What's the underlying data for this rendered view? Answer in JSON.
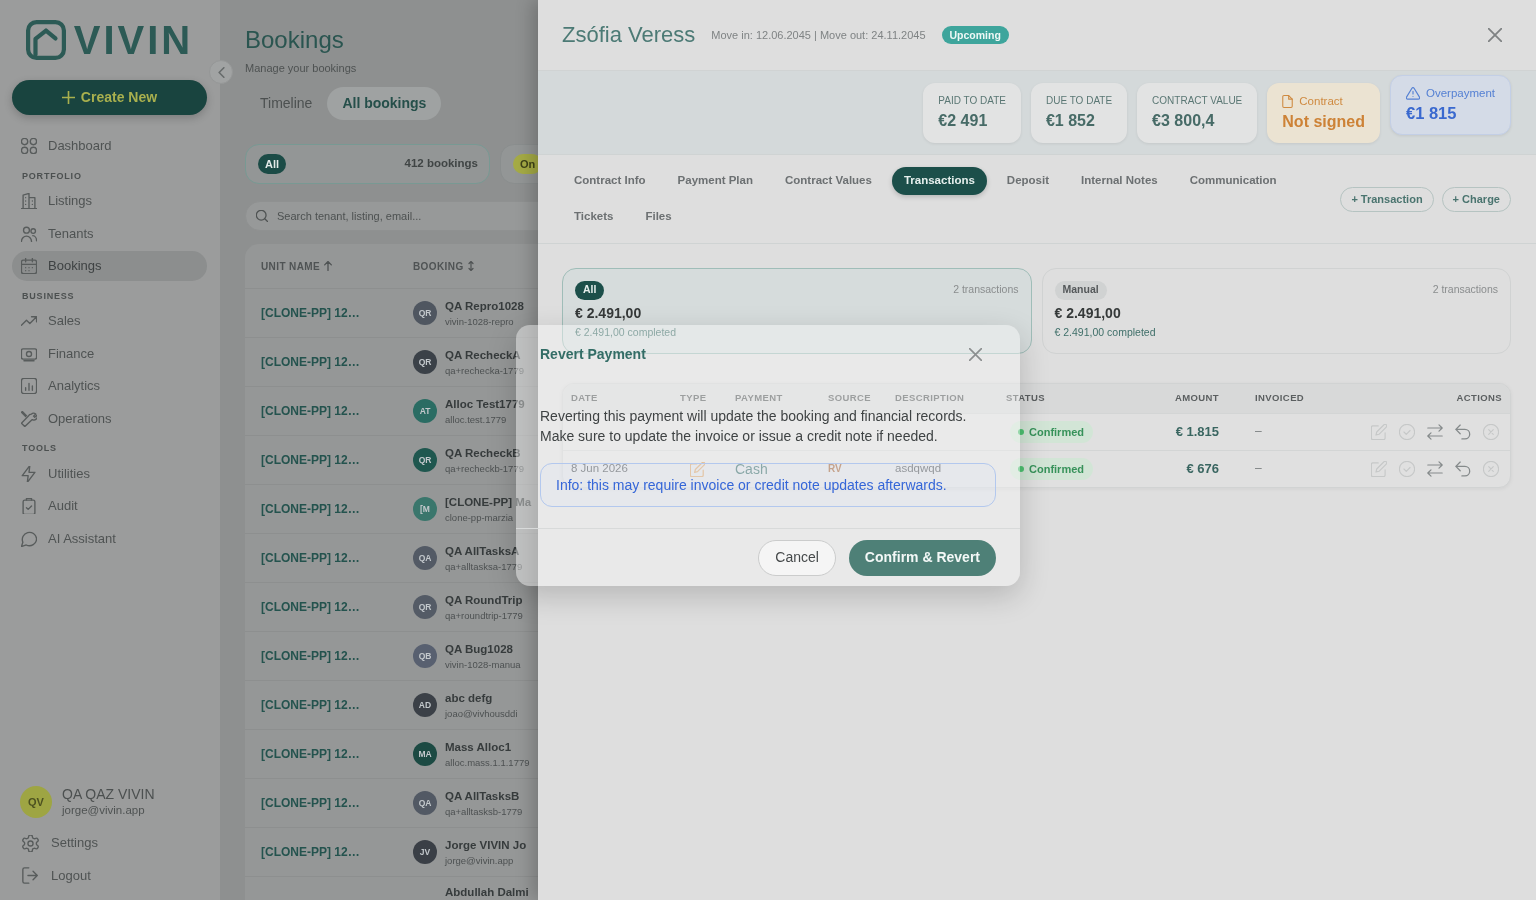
{
  "sidebar": {
    "logo": "VIVIN",
    "create_button": "Create New",
    "nav": [
      {
        "items": [
          {
            "label": "Dashboard",
            "selected": false
          }
        ]
      },
      {
        "heading": "PORTFOLIO",
        "items": [
          {
            "label": "Listings",
            "selected": false
          },
          {
            "label": "Tenants",
            "selected": false
          },
          {
            "label": "Bookings",
            "selected": true
          }
        ]
      },
      {
        "heading": "BUSINESS",
        "items": [
          {
            "label": "Sales",
            "selected": false
          },
          {
            "label": "Finance",
            "selected": false
          },
          {
            "label": "Analytics",
            "selected": false
          },
          {
            "label": "Operations",
            "selected": false
          }
        ]
      },
      {
        "heading": "TOOLS",
        "items": [
          {
            "label": "Utilities",
            "selected": false
          },
          {
            "label": "Audit",
            "selected": false
          },
          {
            "label": "AI Assistant",
            "selected": false
          }
        ]
      }
    ],
    "user": {
      "initials": "QV",
      "name": "QA QAZ VIVIN",
      "email": "jorge@vivin.app"
    },
    "footer_items": [
      {
        "label": "Settings"
      },
      {
        "label": "Logout"
      }
    ]
  },
  "bookings_page": {
    "title": "Bookings",
    "subtitle": "Manage your bookings",
    "view_tabs": [
      {
        "label": "Timeline",
        "selected": false
      },
      {
        "label": "All bookings",
        "selected": true
      }
    ],
    "filters": [
      {
        "label": "All",
        "count": "412 bookings",
        "selected": true,
        "color": "#1b4b46"
      },
      {
        "label": "On",
        "selected": false,
        "color": "#a5ab45"
      }
    ],
    "search": {
      "placeholder": "Search tenant, listing, email..."
    },
    "table": {
      "columns": [
        {
          "label": "UNIT NAME",
          "sorted": true
        },
        {
          "label": "BOOKING",
          "sorted": false
        }
      ],
      "rows": [
        {
          "unit": "[CLONE-PP] 12…",
          "initials": "QR",
          "color": "#4f5660",
          "name": "QA Repro1028",
          "email": "vivin-1028-repro"
        },
        {
          "unit": "[CLONE-PP] 12…",
          "initials": "QR",
          "color": "#3b4148",
          "name": "QA RecheckA",
          "email": "qa+rechecka-1779"
        },
        {
          "unit": "[CLONE-PP] 12…",
          "initials": "AT",
          "color": "#2a6c63",
          "name": "Alloc Test1779",
          "email": "alloc.test.1779"
        },
        {
          "unit": "[CLONE-PP] 12…",
          "initials": "QR",
          "color": "#1f574f",
          "name": "QA RecheckB",
          "email": "qa+recheckb-1779"
        },
        {
          "unit": "[CLONE-PP] 12…",
          "initials": "[M",
          "color": "#3a766c",
          "name": "[CLONE-PP] Ma",
          "email": "clone-pp-marzia"
        },
        {
          "unit": "[CLONE-PP] 12…",
          "initials": "QA",
          "color": "#535a65",
          "name": "QA AllTasksA",
          "email": "qa+alltasksa-1779"
        },
        {
          "unit": "[CLONE-PP] 12…",
          "initials": "QR",
          "color": "#545b66",
          "name": "QA RoundTrip",
          "email": "qa+roundtrip-1779"
        },
        {
          "unit": "[CLONE-PP] 12…",
          "initials": "QB",
          "color": "#586070",
          "name": "QA Bug1028",
          "email": "vivin-1028-manua"
        },
        {
          "unit": "[CLONE-PP] 12…",
          "initials": "AD",
          "color": "#3b4047",
          "name": "abc defg",
          "email": "joao@vivhousddi"
        },
        {
          "unit": "[CLONE-PP] 12…",
          "initials": "MA",
          "color": "#1c4a43",
          "name": "Mass Alloc1",
          "email": "alloc.mass.1.1.1779"
        },
        {
          "unit": "[CLONE-PP] 12…",
          "initials": "QA",
          "color": "#525964",
          "name": "QA AllTasksB",
          "email": "qa+alltasksb-1779"
        },
        {
          "unit": "[CLONE-PP] 12…",
          "initials": "JV",
          "color": "#3a3f46",
          "name": "Jorge VIVIN Jo",
          "email": "jorge@vivin.app"
        },
        {
          "name": "Abdullah Dalmi"
        }
      ]
    }
  },
  "booking_drawer": {
    "title": "Zsófia Veress",
    "dates": "Move in: 12.06.2045 | Move out: 24.11.2045",
    "status": "Upcoming",
    "stats": [
      {
        "kind": "neutral",
        "label": "PAID TO DATE",
        "value": "€2 491"
      },
      {
        "kind": "neutral",
        "label": "DUE TO DATE",
        "value": "€1 852"
      },
      {
        "kind": "neutral",
        "label": "CONTRACT VALUE",
        "value": "€3 800,4"
      },
      {
        "kind": "warning",
        "label": "Contract",
        "value": "Not signed"
      },
      {
        "kind": "alert",
        "label": "Overpayment",
        "value": "€1 815"
      }
    ],
    "tabs": [
      {
        "label": "Contract Info",
        "selected": false
      },
      {
        "label": "Payment Plan",
        "selected": false
      },
      {
        "label": "Contract Values",
        "selected": false
      },
      {
        "label": "Transactions",
        "selected": true
      },
      {
        "label": "Deposit",
        "selected": false
      },
      {
        "label": "Internal Notes",
        "selected": false
      },
      {
        "label": "Communication",
        "selected": false
      },
      {
        "label": "Tickets",
        "selected": false
      },
      {
        "label": "Files",
        "selected": false
      }
    ],
    "actions": [
      "+ Transaction",
      "+ Charge"
    ],
    "groups": [
      {
        "label": "All",
        "count": "2 transactions",
        "total": "€ 2.491,00",
        "completed": "€ 2.491,00 completed",
        "selected": true
      },
      {
        "label": "Manual",
        "count": "2 transactions",
        "total": "€ 2.491,00",
        "completed": "€ 2.491,00 completed",
        "selected": false
      }
    ],
    "table": {
      "columns": [
        "DATE",
        "TYPE",
        "PAYMENT",
        "SOURCE",
        "DESCRIPTION",
        "STATUS",
        "AMOUNT",
        "INVOICED",
        "ACTIONS"
      ],
      "rows": [
        {
          "status": "Confirmed",
          "amount": "€ 1.815",
          "invoiced": "–",
          "actions": [
            {
              "disabled": true
            },
            {
              "disabled": true
            },
            {
              "disabled": false
            },
            {
              "disabled": false
            },
            {
              "disabled": true
            }
          ]
        },
        {
          "details": {
            "date": "8 Jun 2026",
            "payment": "Cash",
            "source": "RV",
            "description": "asdqwqd"
          },
          "status": "Confirmed",
          "amount": "€ 676",
          "invoiced": "–",
          "actions": [
            {
              "disabled": true
            },
            {
              "disabled": true
            },
            {
              "disabled": false
            },
            {
              "disabled": false
            },
            {
              "disabled": true
            }
          ]
        }
      ]
    }
  },
  "revert_dialog": {
    "title": "Revert Payment",
    "message": "Reverting this payment will update the booking and financial records. Make sure to update the invoice or issue a credit note if needed.",
    "info": "Info: this may require invoice or credit note updates afterwards.",
    "buttons": [
      {
        "kind": "secondary",
        "label": "Cancel"
      },
      {
        "kind": "primary",
        "label": "Confirm & Revert"
      }
    ]
  }
}
